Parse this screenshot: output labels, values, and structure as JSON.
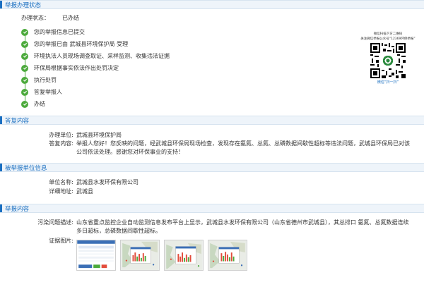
{
  "status": {
    "header": "举报办理状态",
    "label": "办理状态：",
    "value": "已办结",
    "steps": [
      "您的举报信息已提交",
      "您的举报已由 武城县环境保护局 受理",
      "环境执法人员现场调查取证、采样监测、收集违法证据",
      "环保局根据事实依法作出处罚决定",
      "执行处罚",
      "答复举报人",
      "办结"
    ],
    "qr": {
      "caption1": "微信扫描下方二维码",
      "caption2": "关注微信举报公众号“12369环保举报”",
      "footer": "微信“扫一扫”"
    }
  },
  "reply": {
    "header": "答复内容",
    "unit_label": "办理单位:",
    "unit_value": "武城县环境保护局",
    "content_label": "答复内容:",
    "content_value": "举报人您好！您反映的问题，经武城县环保局现场检查，发现存在氨氮、总氮、总磷数据间歇性超标等违法问题，武城县环保局已对该公司依法处理。感谢您对环保事业的支持！"
  },
  "reported": {
    "header": "被举报单位信息",
    "name_label": "单位名称:",
    "name_value": "武城县水发环保有限公司",
    "addr_label": "详细地址:",
    "addr_value": "武城县"
  },
  "report": {
    "header": "举报内容",
    "problem_label": "污染问题描述:",
    "problem_value": "山东省重点监控企业自动监测信息发布平台上显示，武城县水发环保有限公司（山东省德州市武城县），其总排口 氨氮、总氮数据连续多日超标，总磷数据间歇性超标。",
    "evidence_label": "证据图片:"
  },
  "colors": {
    "accent": "#1a6fc1",
    "success": "#4caa3c"
  }
}
